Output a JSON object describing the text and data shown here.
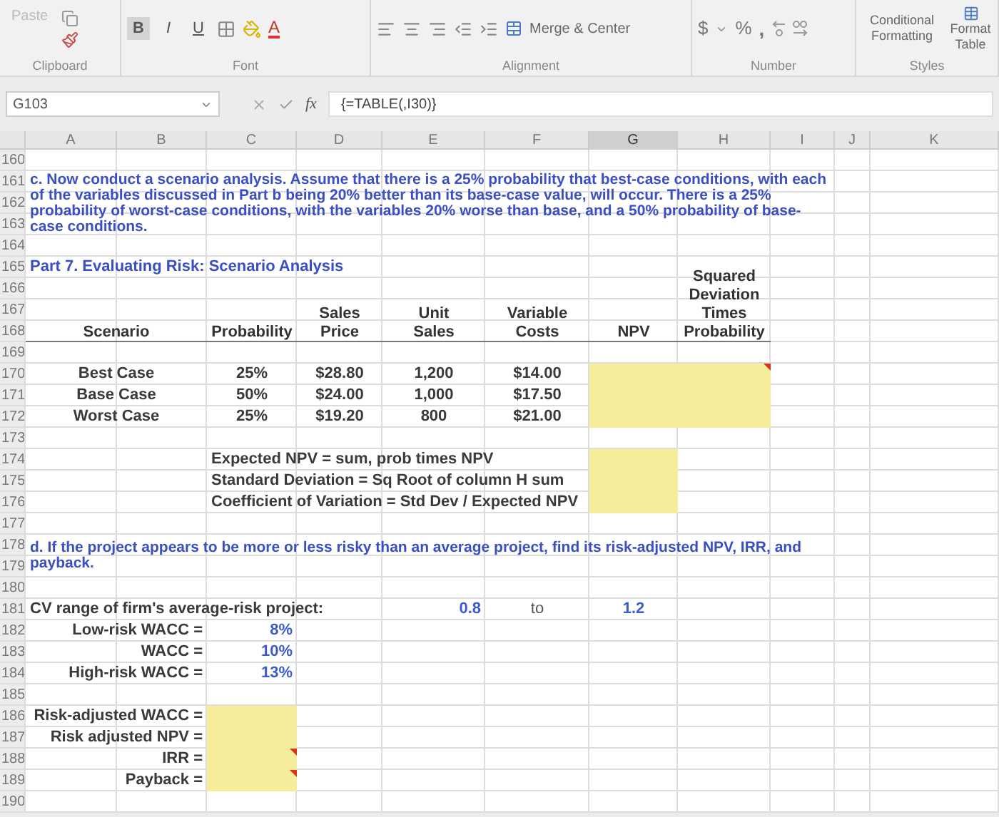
{
  "ribbon": {
    "paste": "Paste",
    "font_buttons": [
      {
        "label": "B",
        "selected": true
      },
      {
        "label": "I",
        "selected": false
      },
      {
        "label": "U",
        "selected": false
      }
    ],
    "font_color": "A",
    "merge": "Merge & Center",
    "currency": "$",
    "percent": "%",
    "comma": ",",
    "conditional": "Conditional Formatting",
    "format_table": "Format Table",
    "groups": [
      "Clipboard",
      "Font",
      "Alignment",
      "Number",
      "Styles"
    ]
  },
  "formula_bar": {
    "name_box": "G103",
    "fx": "fx",
    "formula": "{=TABLE(,I30)}"
  },
  "columns": [
    {
      "label": "A",
      "selected": false
    },
    {
      "label": "B",
      "selected": false
    },
    {
      "label": "C",
      "selected": false
    },
    {
      "label": "D",
      "selected": false
    },
    {
      "label": "E",
      "selected": false
    },
    {
      "label": "F",
      "selected": false
    },
    {
      "label": "G",
      "selected": true
    },
    {
      "label": "H",
      "selected": false
    },
    {
      "label": "I",
      "selected": false
    },
    {
      "label": "J",
      "selected": false
    },
    {
      "label": "K",
      "selected": false
    }
  ],
  "rows": [
    "160",
    "161",
    "162",
    "163",
    "164",
    "165",
    "166",
    "167",
    "168",
    "169",
    "170",
    "171",
    "172",
    "173",
    "174",
    "175",
    "176",
    "177",
    "178",
    "179",
    "180",
    "181",
    "182",
    "183",
    "184",
    "185",
    "186",
    "187",
    "188",
    "189",
    "190"
  ],
  "cells": [
    {
      "kind": "heading",
      "text": "c.  Now conduct a scenario analysis.  Assume that there is a 25% probability that best-case conditions, with each of the variables discussed in Part b being 20% better than its base-case value, will occur.  There is a 25% probability of worst-case conditions, with the variables 20% worse than base, and a 50% probability of base-case conditions."
    },
    {
      "kind": "heading",
      "text": "Part 7.  Evaluating Risk:  Scenario Analysis"
    },
    {
      "kind": "column-header",
      "text": "Scenario"
    },
    {
      "kind": "column-header",
      "text": "Probability"
    },
    {
      "kind": "column-header",
      "text": "Sales Price"
    },
    {
      "kind": "column-header",
      "text": "Unit Sales"
    },
    {
      "kind": "column-header",
      "text": "Variable Costs"
    },
    {
      "kind": "column-header",
      "text": "NPV"
    },
    {
      "kind": "column-header",
      "text": "Squared Deviation Times Probability"
    },
    {
      "kind": "label",
      "text": "Best Case"
    },
    {
      "kind": "label",
      "text": "25%"
    },
    {
      "kind": "label",
      "text": "$28.80"
    },
    {
      "kind": "label",
      "text": "1,200"
    },
    {
      "kind": "label",
      "text": "$14.00"
    },
    {
      "kind": "label",
      "text": "Base Case"
    },
    {
      "kind": "label",
      "text": "50%"
    },
    {
      "kind": "label",
      "text": "$24.00"
    },
    {
      "kind": "label",
      "text": "1,000"
    },
    {
      "kind": "label",
      "text": "$17.50"
    },
    {
      "kind": "label",
      "text": "Worst Case"
    },
    {
      "kind": "label",
      "text": "25%"
    },
    {
      "kind": "label",
      "text": "$19.20"
    },
    {
      "kind": "label",
      "text": "800"
    },
    {
      "kind": "label",
      "text": "$21.00"
    },
    {
      "kind": "label",
      "text": "Expected NPV = sum, prob times NPV"
    },
    {
      "kind": "label",
      "text": "Standard Deviation  = Sq Root of column H sum"
    },
    {
      "kind": "label",
      "text": "Coefficient of Variation = Std Dev / Expected NPV"
    },
    {
      "kind": "heading",
      "text": "d.  If the project appears to be more or less risky than an average project, find its risk-adjusted NPV, IRR, and payback."
    },
    {
      "kind": "label",
      "text": "CV range of firm's average-risk project:"
    },
    {
      "kind": "input",
      "text": "0.8"
    },
    {
      "kind": "plain",
      "text": "to"
    },
    {
      "kind": "input",
      "text": "1.2"
    },
    {
      "kind": "label",
      "text": "Low-risk WACC ="
    },
    {
      "kind": "input",
      "text": "8%"
    },
    {
      "kind": "label",
      "text": "WACC ="
    },
    {
      "kind": "input",
      "text": "10%"
    },
    {
      "kind": "label",
      "text": "High-risk WACC ="
    },
    {
      "kind": "input",
      "text": "13%"
    },
    {
      "kind": "label",
      "text": "Risk-adjusted WACC ="
    },
    {
      "kind": "label",
      "text": "Risk adjusted NPV ="
    },
    {
      "kind": "label",
      "text": "IRR ="
    },
    {
      "kind": "label",
      "text": "Payback ="
    }
  ]
}
